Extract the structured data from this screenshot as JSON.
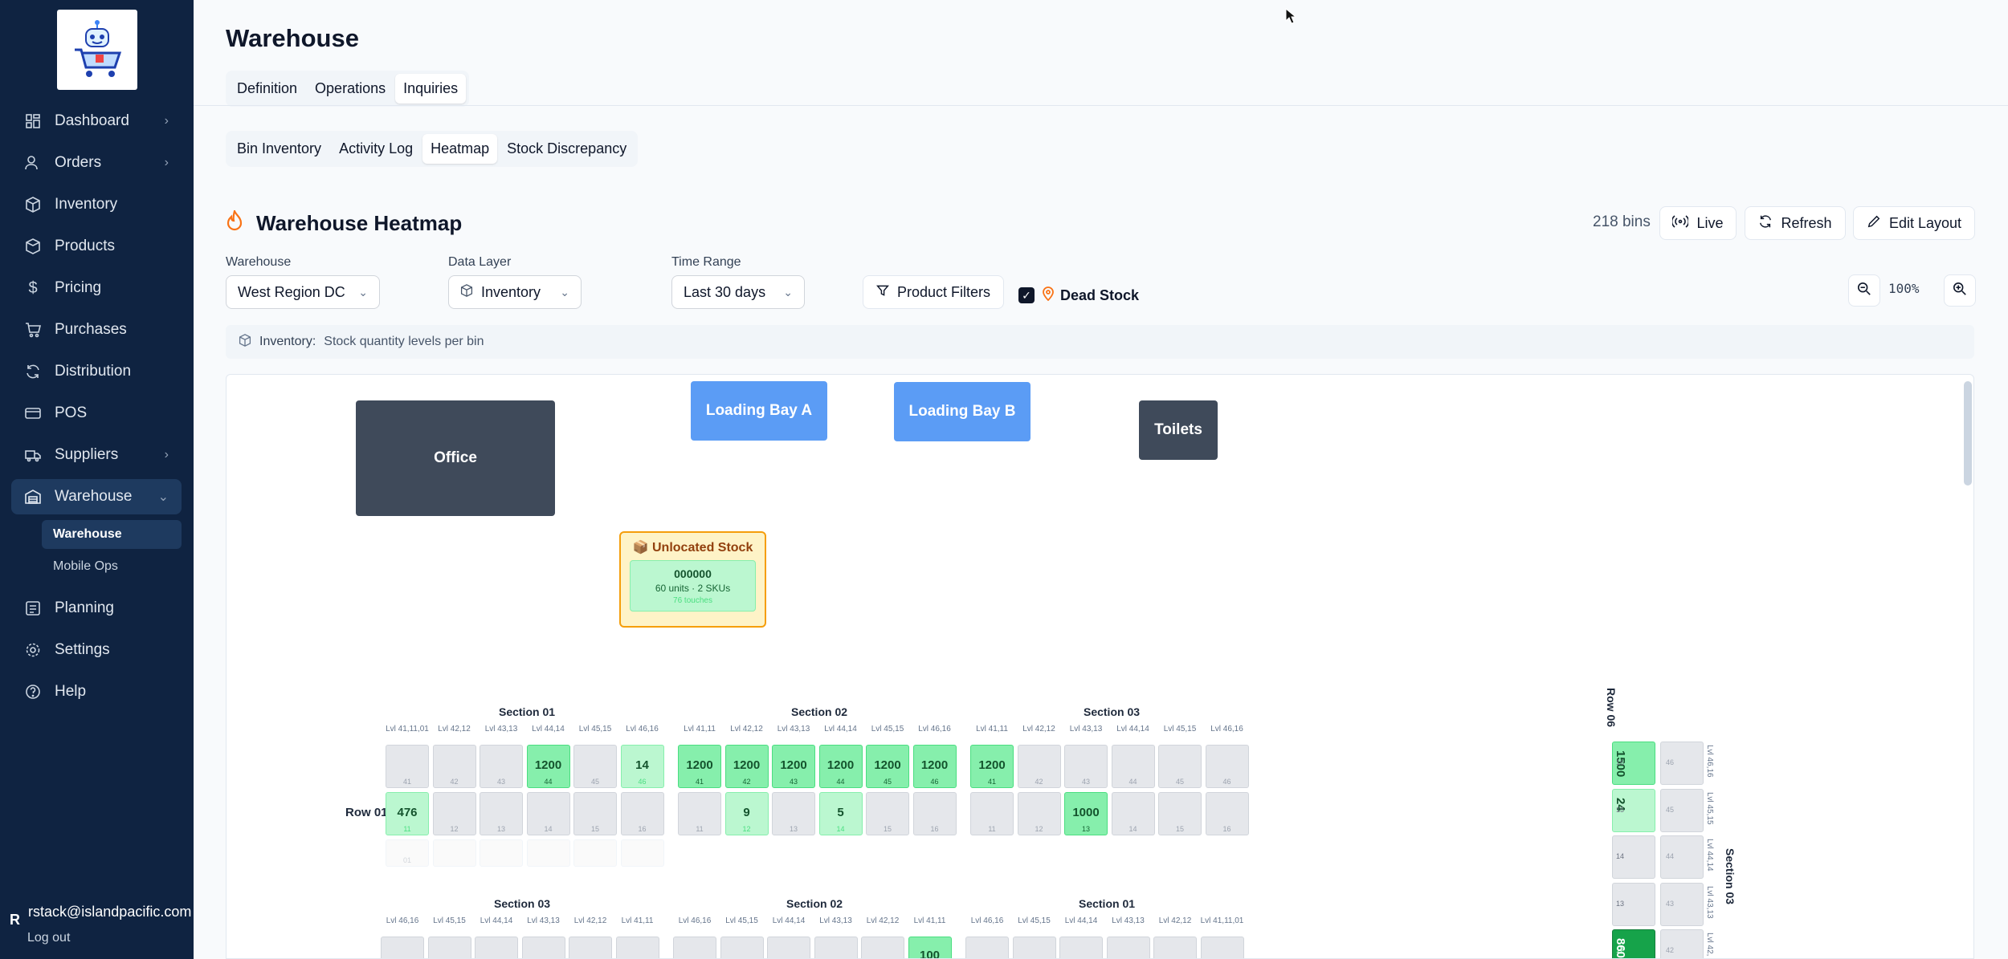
{
  "sidebar": {
    "items": [
      {
        "label": "Dashboard",
        "icon": "grid-icon",
        "chevron": true
      },
      {
        "label": "Orders",
        "icon": "users-icon",
        "chevron": true
      },
      {
        "label": "Inventory",
        "icon": "box-icon",
        "chevron": false
      },
      {
        "label": "Products",
        "icon": "package-icon",
        "chevron": false
      },
      {
        "label": "Pricing",
        "icon": "dollar-icon",
        "chevron": false
      },
      {
        "label": "Purchases",
        "icon": "cart-icon",
        "chevron": false
      },
      {
        "label": "Distribution",
        "icon": "refresh-icon",
        "chevron": false
      },
      {
        "label": "POS",
        "icon": "card-icon",
        "chevron": false
      },
      {
        "label": "Suppliers",
        "icon": "truck-icon",
        "chevron": true
      },
      {
        "label": "Warehouse",
        "icon": "warehouse-icon",
        "chevron": true
      },
      {
        "label": "Planning",
        "icon": "calendar-icon",
        "chevron": false
      },
      {
        "label": "Settings",
        "icon": "gear-icon",
        "chevron": false
      },
      {
        "label": "Help",
        "icon": "help-icon",
        "chevron": false
      }
    ],
    "sub_items": [
      "Warehouse",
      "Mobile Ops"
    ],
    "user_initial": "R",
    "user_email": "rstack@islandpacific.com",
    "logout": "Log out"
  },
  "page": {
    "title": "Warehouse",
    "tabs": [
      "Definition",
      "Operations",
      "Inquiries"
    ],
    "active_tab": "Inquiries",
    "subtabs": [
      "Bin Inventory",
      "Activity Log",
      "Heatmap",
      "Stock Discrepancy"
    ],
    "active_subtab": "Heatmap"
  },
  "heatmap": {
    "title": "Warehouse Heatmap",
    "bins_count": "218 bins",
    "live_label": "Live",
    "refresh_label": "Refresh",
    "edit_label": "Edit Layout",
    "warehouse_label": "Warehouse",
    "warehouse_value": "West Region DC",
    "layer_label": "Data Layer",
    "layer_value": "Inventory",
    "time_label": "Time Range",
    "time_value": "Last 30 days",
    "product_filters": "Product Filters",
    "dead_stock": "Dead Stock",
    "zoom": "100%",
    "info_key": "Inventory:",
    "info_text": "Stock quantity levels per bin",
    "colors": {
      "sidebar": "#0f2341",
      "zone_dark": "#3f4a5a",
      "zone_blue": "#5b9cf5",
      "heat_low": "#bbf7d0",
      "heat_mid": "#86efac",
      "heat_high": "#16a34a"
    }
  },
  "layout": {
    "zones": [
      {
        "label": "Office"
      },
      {
        "label": "Loading Bay A"
      },
      {
        "label": "Loading Bay B"
      },
      {
        "label": "Toilets"
      }
    ],
    "unlocated": {
      "title": "📦 Unlocated Stock",
      "code": "000000",
      "summary": "60 units · 2 SKUs",
      "touches": "76 touches"
    },
    "top_sections": [
      {
        "title": "Section 01",
        "levels": [
          "Lvl 41,11,01",
          "Lvl 42,12",
          "Lvl 43,13",
          "Lvl 44,14",
          "Lvl 45,15",
          "Lvl 46,16"
        ],
        "row1": [
          [
            "",
            "41",
            0
          ],
          [
            "",
            "42",
            0
          ],
          [
            "",
            "43",
            0
          ],
          [
            "1200",
            "44",
            2
          ],
          [
            "",
            "45",
            0
          ],
          [
            "14",
            "46",
            1
          ]
        ],
        "row2": [
          [
            "476",
            "11",
            1
          ],
          [
            "",
            "12",
            0
          ],
          [
            "",
            "13",
            0
          ],
          [
            "",
            "14",
            0
          ],
          [
            "",
            "15",
            0
          ],
          [
            "",
            "16",
            0
          ]
        ]
      },
      {
        "title": "Section 02",
        "levels": [
          "Lvl 41,11",
          "Lvl 42,12",
          "Lvl 43,13",
          "Lvl 44,14",
          "Lvl 45,15",
          "Lvl 46,16"
        ],
        "row1": [
          [
            "1200",
            "41",
            2
          ],
          [
            "1200",
            "42",
            2
          ],
          [
            "1200",
            "43",
            2
          ],
          [
            "1200",
            "44",
            2
          ],
          [
            "1200",
            "45",
            2
          ],
          [
            "1200",
            "46",
            2
          ]
        ],
        "row2": [
          [
            "",
            "11",
            0
          ],
          [
            "9",
            "12",
            1
          ],
          [
            "",
            "13",
            0
          ],
          [
            "5",
            "14",
            1
          ],
          [
            "",
            "15",
            0
          ],
          [
            "",
            "16",
            0
          ]
        ]
      },
      {
        "title": "Section 03",
        "levels": [
          "Lvl 41,11",
          "Lvl 42,12",
          "Lvl 43,13",
          "Lvl 44,14",
          "Lvl 45,15",
          "Lvl 46,16"
        ],
        "row1": [
          [
            "1200",
            "41",
            2
          ],
          [
            "",
            "42",
            0
          ],
          [
            "",
            "43",
            0
          ],
          [
            "",
            "44",
            0
          ],
          [
            "",
            "45",
            0
          ],
          [
            "",
            "46",
            0
          ]
        ],
        "row2": [
          [
            "",
            "11",
            0
          ],
          [
            "",
            "12",
            0
          ],
          [
            "1000",
            "13",
            2
          ],
          [
            "",
            "14",
            0
          ],
          [
            "",
            "15",
            0
          ],
          [
            "",
            "16",
            0
          ]
        ]
      }
    ],
    "row01_label": "Row 01",
    "ghost_label": "01",
    "bottom_sections": [
      {
        "title": "Section 03",
        "levels": [
          "Lvl 46,16",
          "Lvl 45,15",
          "Lvl 44,14",
          "Lvl 43,13",
          "Lvl 42,12",
          "Lvl 41,11"
        ]
      },
      {
        "title": "Section 02",
        "levels": [
          "Lvl 46,16",
          "Lvl 45,15",
          "Lvl 44,14",
          "Lvl 43,13",
          "Lvl 42,12",
          "Lvl 41,11"
        ],
        "last_value": "100"
      },
      {
        "title": "Section 01",
        "levels": [
          "Lvl 46,16",
          "Lvl 45,15",
          "Lvl 44,14",
          "Lvl 43,13",
          "Lvl 42,12",
          "Lvl 41,11,01"
        ]
      }
    ],
    "row06": {
      "label": "Row 06",
      "section": "Section 03",
      "levels": [
        "Lvl 46,16",
        "Lvl 45,15",
        "Lvl 44,14",
        "Lvl 43,13",
        "Lvl 42,"
      ],
      "values": [
        "1500",
        "24",
        "",
        "",
        "860"
      ],
      "subs": [
        "16",
        "15",
        "14",
        "13",
        "12"
      ],
      "right_subs": [
        "46",
        "45",
        "44",
        "43",
        "42"
      ]
    }
  }
}
